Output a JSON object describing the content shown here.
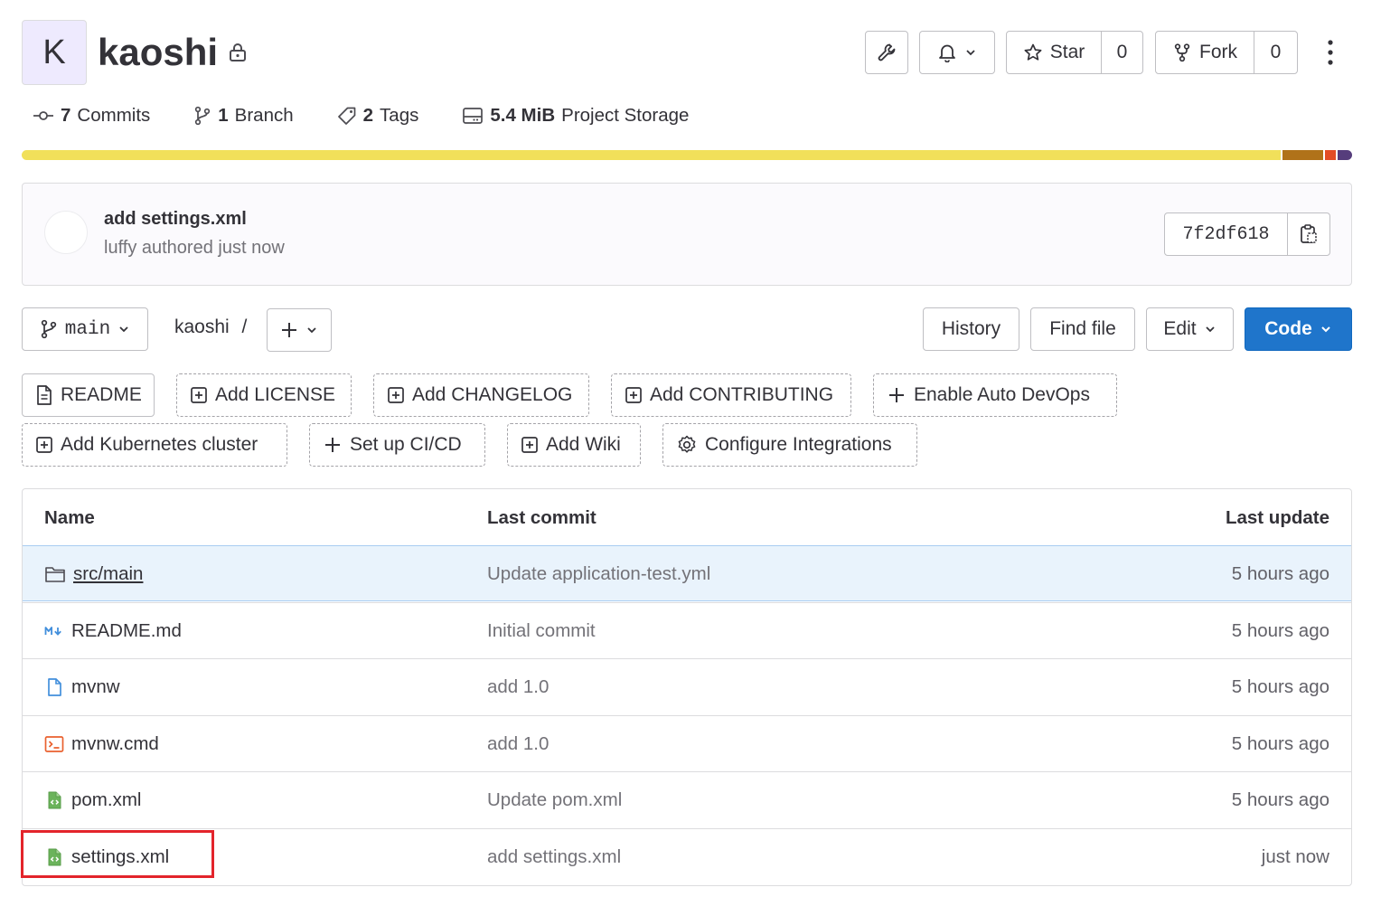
{
  "project": {
    "avatar_letter": "K",
    "name": "kaoshi",
    "visibility_icon": "lock-icon"
  },
  "actions": {
    "settings_icon": "wrench-icon",
    "notifications_icon": "bell-icon",
    "star_label": "Star",
    "star_count": "0",
    "fork_label": "Fork",
    "fork_count": "0",
    "more_icon": "kebab-icon"
  },
  "stats": {
    "commits_count": "7",
    "commits_label": "Commits",
    "branch_count": "1",
    "branch_label": "Branch",
    "tags_count": "2",
    "tags_label": "Tags",
    "storage_size": "5.4 MiB",
    "storage_label": "Project Storage"
  },
  "languages": [
    {
      "fraction": 0.95,
      "color": "#f1e05a"
    },
    {
      "fraction": 0.031,
      "color": "#b07219"
    },
    {
      "fraction": 0.008,
      "color": "#e34c26"
    },
    {
      "fraction": 0.011,
      "color": "#563d7c"
    }
  ],
  "last_commit": {
    "message": "add settings.xml",
    "meta": "luffy authored just now",
    "sha": "7f2df618"
  },
  "toolbar": {
    "branch": "main",
    "path_root": "kaoshi",
    "separator": "/",
    "history": "History",
    "find_file": "Find file",
    "edit": "Edit",
    "code": "Code"
  },
  "quick_actions": [
    "README",
    "Add LICENSE",
    "Add CHANGELOG",
    "Add CONTRIBUTING",
    "Enable Auto DevOps",
    "Add Kubernetes cluster",
    "Set up CI/CD",
    "Add Wiki",
    "Configure Integrations"
  ],
  "table": {
    "headers": {
      "name": "Name",
      "last_commit": "Last commit",
      "last_update": "Last update"
    },
    "rows": [
      {
        "name": "src/main",
        "icon": "folder-icon",
        "commit": "Update application-test.yml",
        "updated": "5 hours ago"
      },
      {
        "name": "README.md",
        "icon": "markdown-icon",
        "commit": "Initial commit",
        "updated": "5 hours ago"
      },
      {
        "name": "mvnw",
        "icon": "file-icon",
        "commit": "add 1.0",
        "updated": "5 hours ago"
      },
      {
        "name": "mvnw.cmd",
        "icon": "terminal-icon",
        "commit": "add 1.0",
        "updated": "5 hours ago"
      },
      {
        "name": "pom.xml",
        "icon": "xml-icon",
        "commit": "Update pom.xml",
        "updated": "5 hours ago"
      },
      {
        "name": "settings.xml",
        "icon": "xml-icon",
        "commit": "add settings.xml",
        "updated": "just now"
      }
    ]
  }
}
